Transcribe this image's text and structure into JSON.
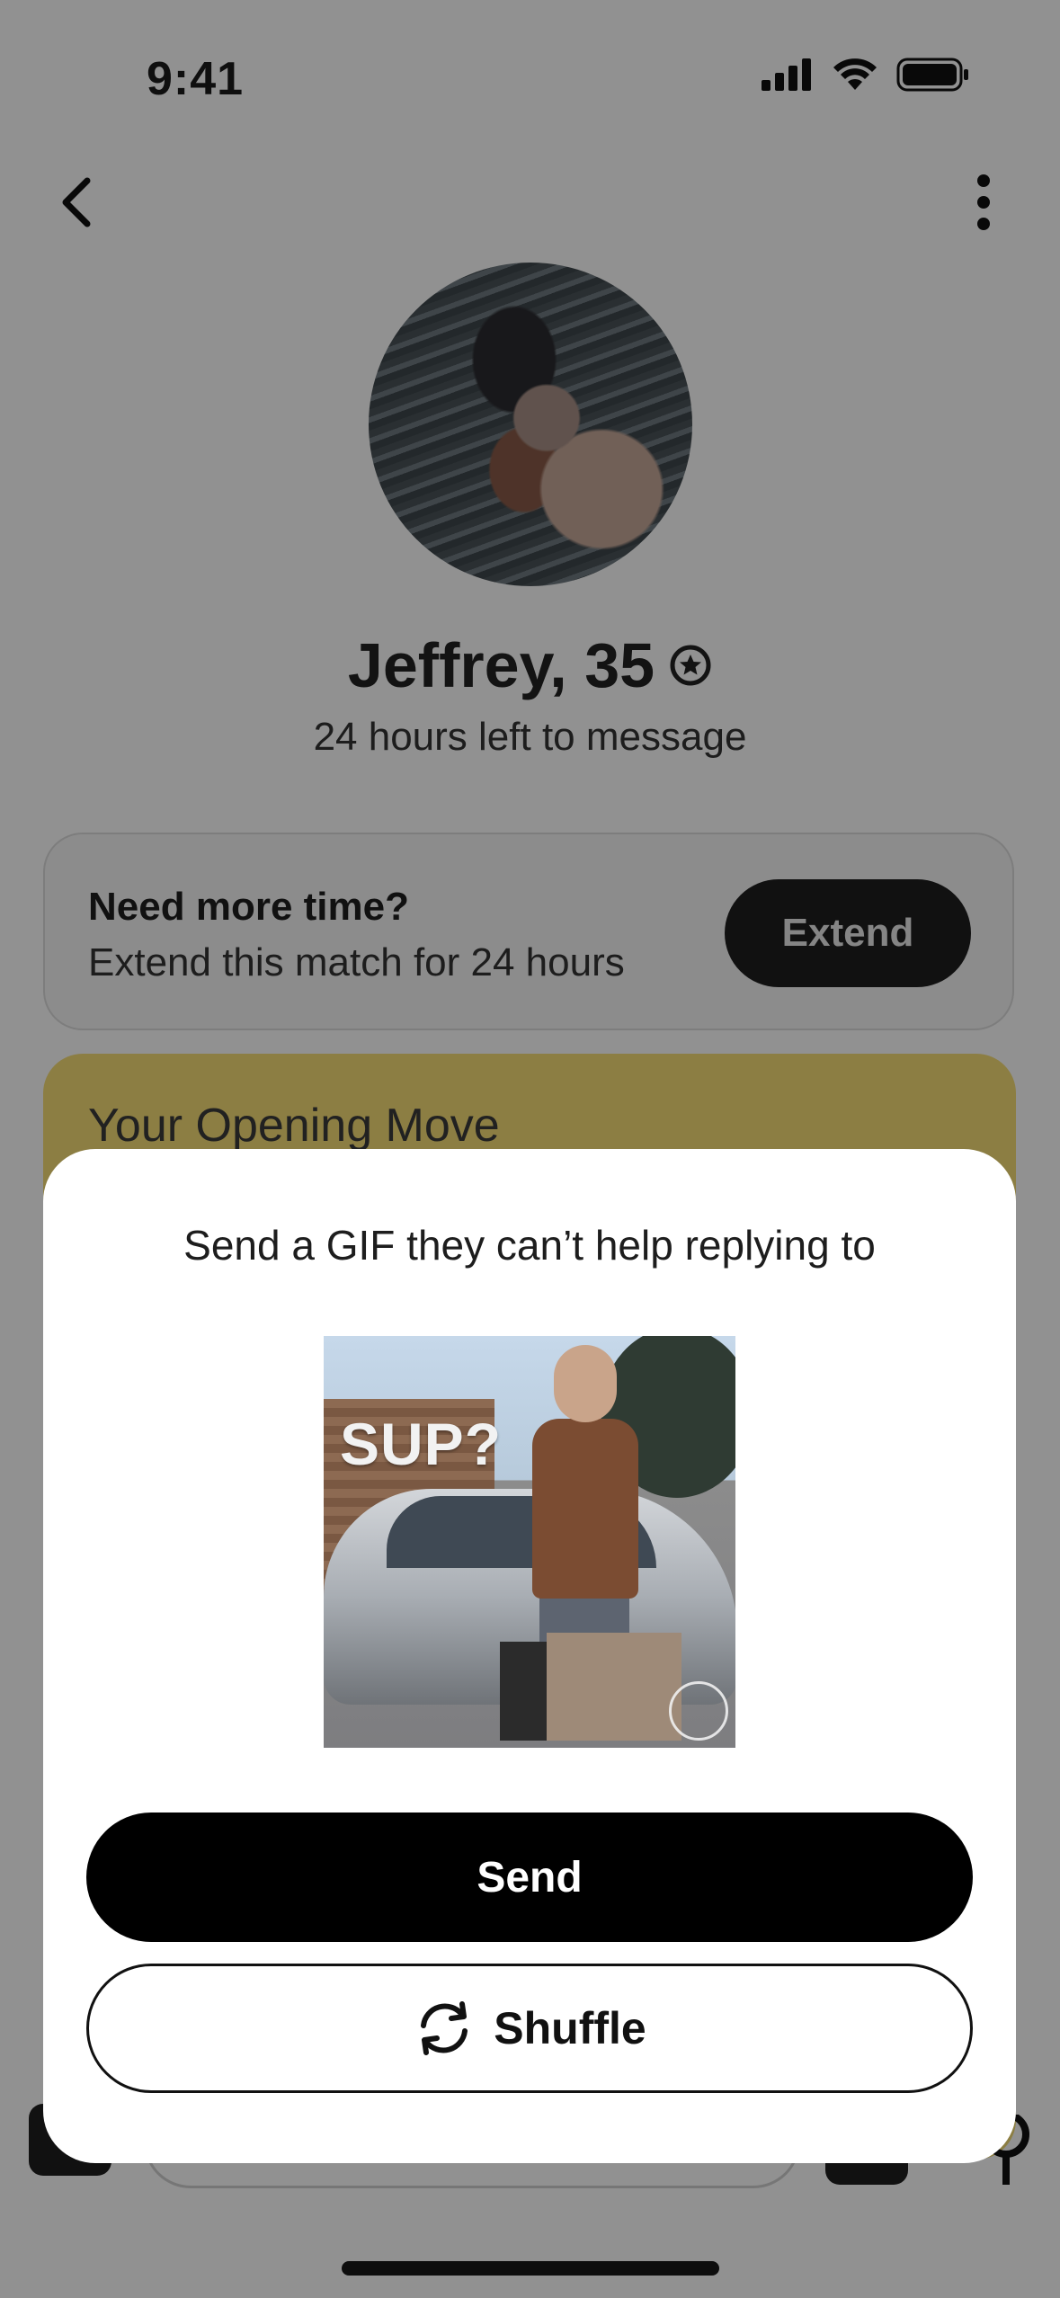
{
  "status_bar": {
    "time": "9:41"
  },
  "profile": {
    "name_age": "Jeffrey, 35",
    "time_left": "24 hours left to message"
  },
  "extend_card": {
    "title": "Need more time?",
    "subtitle": "Extend this match for 24 hours",
    "button_label": "Extend"
  },
  "opening_move": {
    "title": "Your Opening Move"
  },
  "gif_modal": {
    "title": "Send a GIF they can’t help replying to",
    "gif_caption": "SUP?",
    "send_label": "Send",
    "shuffle_label": "Shuffle"
  },
  "colors": {
    "primary_button": "#000000",
    "opening_move_bg": "#f6dd77",
    "overlay": "rgba(0,0,0,0.43)"
  },
  "icons": [
    "back-chevron-icon",
    "more-vertical-icon",
    "verified-badge-icon",
    "shuffle-icon",
    "signal-icon",
    "wifi-icon",
    "battery-icon"
  ]
}
